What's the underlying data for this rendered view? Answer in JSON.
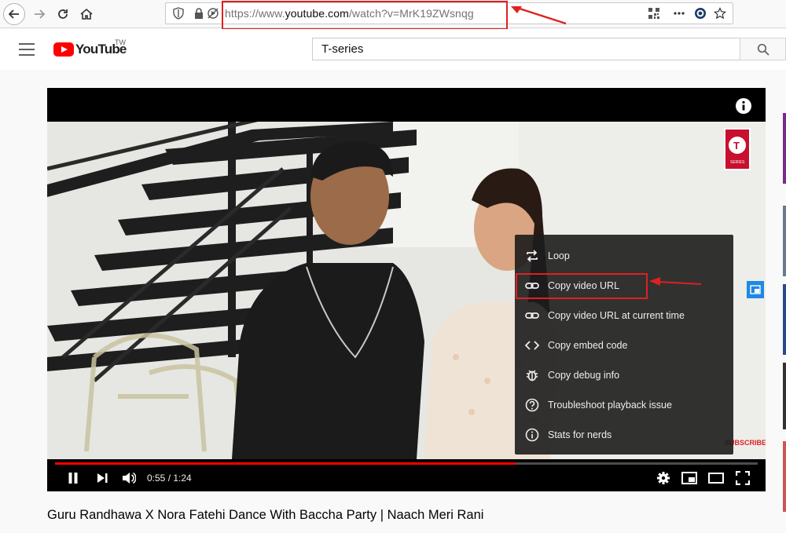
{
  "browser": {
    "url_prefix": "https://www.",
    "url_domain": "youtube.com",
    "url_path": "/watch?v=MrK19ZWsnqg"
  },
  "youtube": {
    "logo_text": "YouTube",
    "logo_tm": "TW",
    "search_value": "T-series"
  },
  "player": {
    "time_current": "0:55",
    "time_total": "1:24",
    "time_display": "0:55 / 1:24",
    "progress_fraction": 0.655,
    "channel_badge": "SERIES",
    "subscribe_watermark": "SUBSCRIBE",
    "context_menu": [
      {
        "icon": "loop-icon",
        "label": "Loop"
      },
      {
        "icon": "link-icon",
        "label": "Copy video URL"
      },
      {
        "icon": "link-icon",
        "label": "Copy video URL at current time"
      },
      {
        "icon": "embed-code-icon",
        "label": "Copy embed code"
      },
      {
        "icon": "bug-icon",
        "label": "Copy debug info"
      },
      {
        "icon": "help-circle-icon",
        "label": "Troubleshoot playback issue"
      },
      {
        "icon": "info-circle-icon",
        "label": "Stats for nerds"
      }
    ]
  },
  "video": {
    "title": "Guru Randhawa X Nora Fatehi Dance With Baccha Party | Naach Meri Rani"
  },
  "colors": {
    "annotation": "#e02020",
    "youtube_red": "#ff0000",
    "menu_bg": "#1c1c1c"
  }
}
